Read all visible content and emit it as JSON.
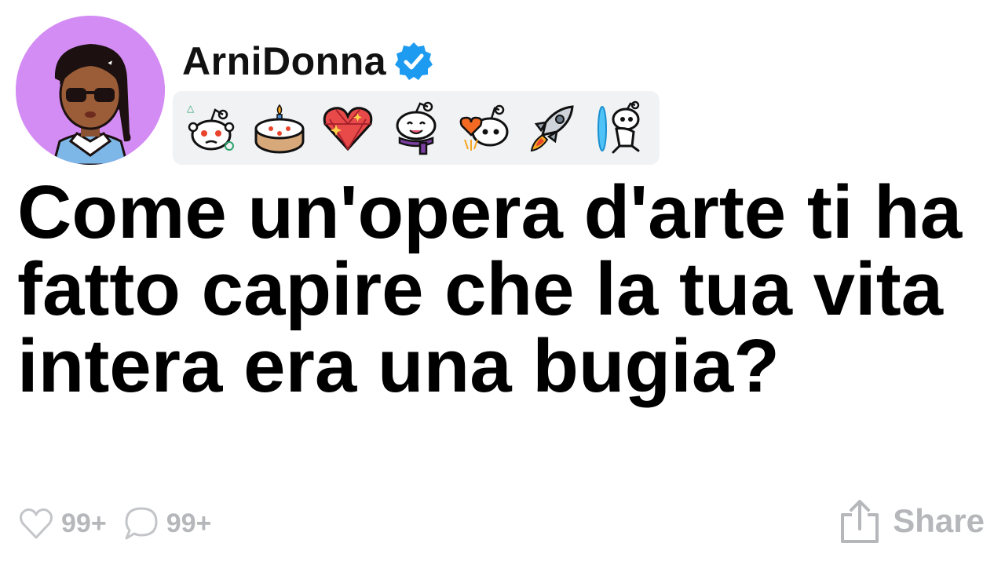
{
  "post": {
    "author": {
      "username": "ArniDonna",
      "avatar_icon": "avatar-girl-sunglasses-icon",
      "verified_icon": "verified-check-icon",
      "avatar_bg": "#d48cf5",
      "verified_color": "#1d9bf0"
    },
    "badges": [
      {
        "icon": "reddit-alien-thinking-icon"
      },
      {
        "icon": "birthday-cake-icon"
      },
      {
        "icon": "sparkle-heart-gem-icon"
      },
      {
        "icon": "reddit-alien-scarf-icon"
      },
      {
        "icon": "reddit-alien-heart-icon"
      },
      {
        "icon": "rocket-icon"
      },
      {
        "icon": "reddit-alien-portal-icon"
      }
    ],
    "title": "Come un'opera d'arte ti ha fatto capire che la tua vita intera era una bugia?",
    "stats": {
      "likes": "99+",
      "comments": "99+",
      "like_icon": "heart-outline-icon",
      "comment_icon": "speech-bubble-icon"
    },
    "share": {
      "label": "Share",
      "icon": "share-upload-icon"
    }
  }
}
